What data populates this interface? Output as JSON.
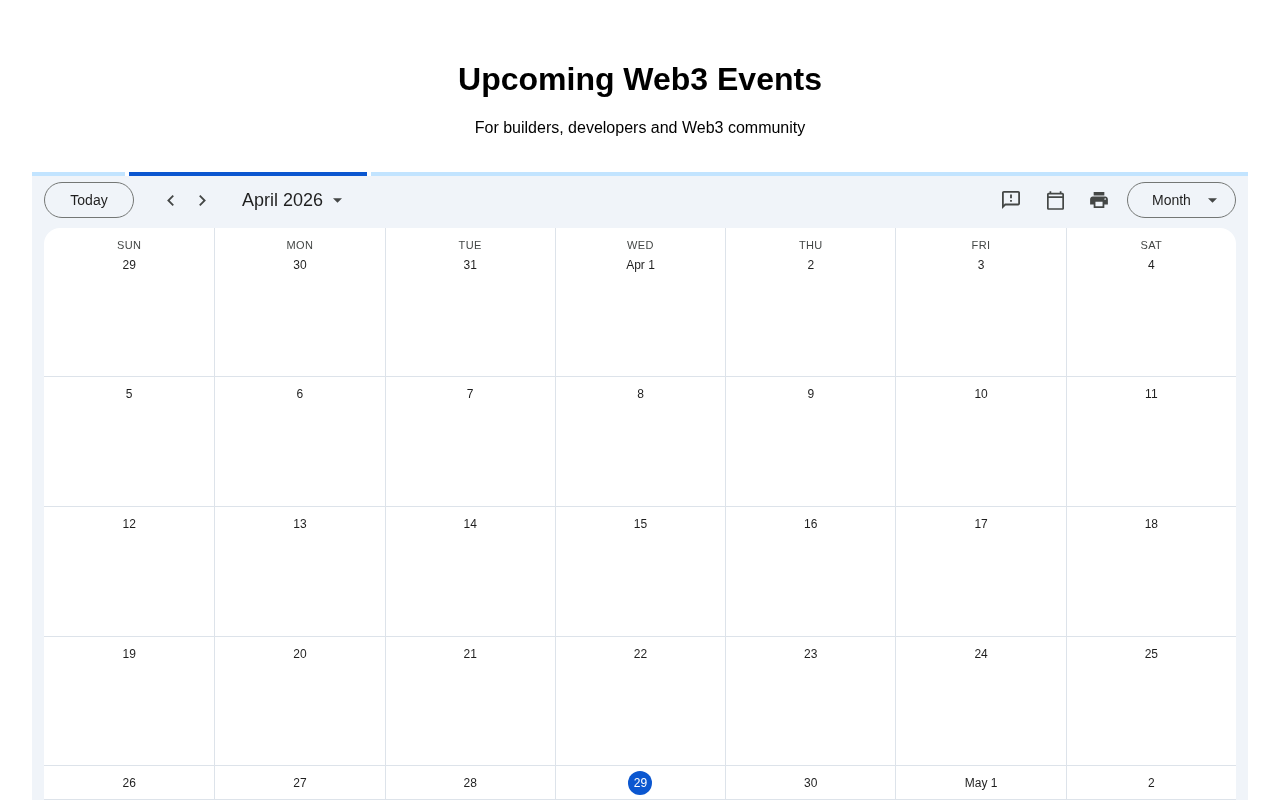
{
  "page": {
    "title": "Upcoming Web3 Events",
    "subtitle": "For builders, developers and Web3 community"
  },
  "calendar": {
    "loading": true,
    "toolbar": {
      "today_button": "Today",
      "period": "April 2026",
      "view_button": "Month"
    },
    "weekdays": [
      "SUN",
      "MON",
      "TUE",
      "WED",
      "THU",
      "FRI",
      "SAT"
    ],
    "weeks": [
      [
        {
          "day": "29",
          "today": false
        },
        {
          "day": "30",
          "today": false
        },
        {
          "day": "31",
          "today": false
        },
        {
          "day": "Apr 1",
          "today": false
        },
        {
          "day": "2",
          "today": false
        },
        {
          "day": "3",
          "today": false
        },
        {
          "day": "4",
          "today": false
        }
      ],
      [
        {
          "day": "5",
          "today": false
        },
        {
          "day": "6",
          "today": false
        },
        {
          "day": "7",
          "today": false
        },
        {
          "day": "8",
          "today": false
        },
        {
          "day": "9",
          "today": false
        },
        {
          "day": "10",
          "today": false
        },
        {
          "day": "11",
          "today": false
        }
      ],
      [
        {
          "day": "12",
          "today": false
        },
        {
          "day": "13",
          "today": false
        },
        {
          "day": "14",
          "today": false
        },
        {
          "day": "15",
          "today": false
        },
        {
          "day": "16",
          "today": false
        },
        {
          "day": "17",
          "today": false
        },
        {
          "day": "18",
          "today": false
        }
      ],
      [
        {
          "day": "19",
          "today": false
        },
        {
          "day": "20",
          "today": false
        },
        {
          "day": "21",
          "today": false
        },
        {
          "day": "22",
          "today": false
        },
        {
          "day": "23",
          "today": false
        },
        {
          "day": "24",
          "today": false
        },
        {
          "day": "25",
          "today": false
        }
      ],
      [
        {
          "day": "26",
          "today": false
        },
        {
          "day": "27",
          "today": false
        },
        {
          "day": "28",
          "today": false
        },
        {
          "day": "29",
          "today": true
        },
        {
          "day": "30",
          "today": false
        },
        {
          "day": "May 1",
          "today": false
        },
        {
          "day": "2",
          "today": false
        }
      ]
    ]
  }
}
